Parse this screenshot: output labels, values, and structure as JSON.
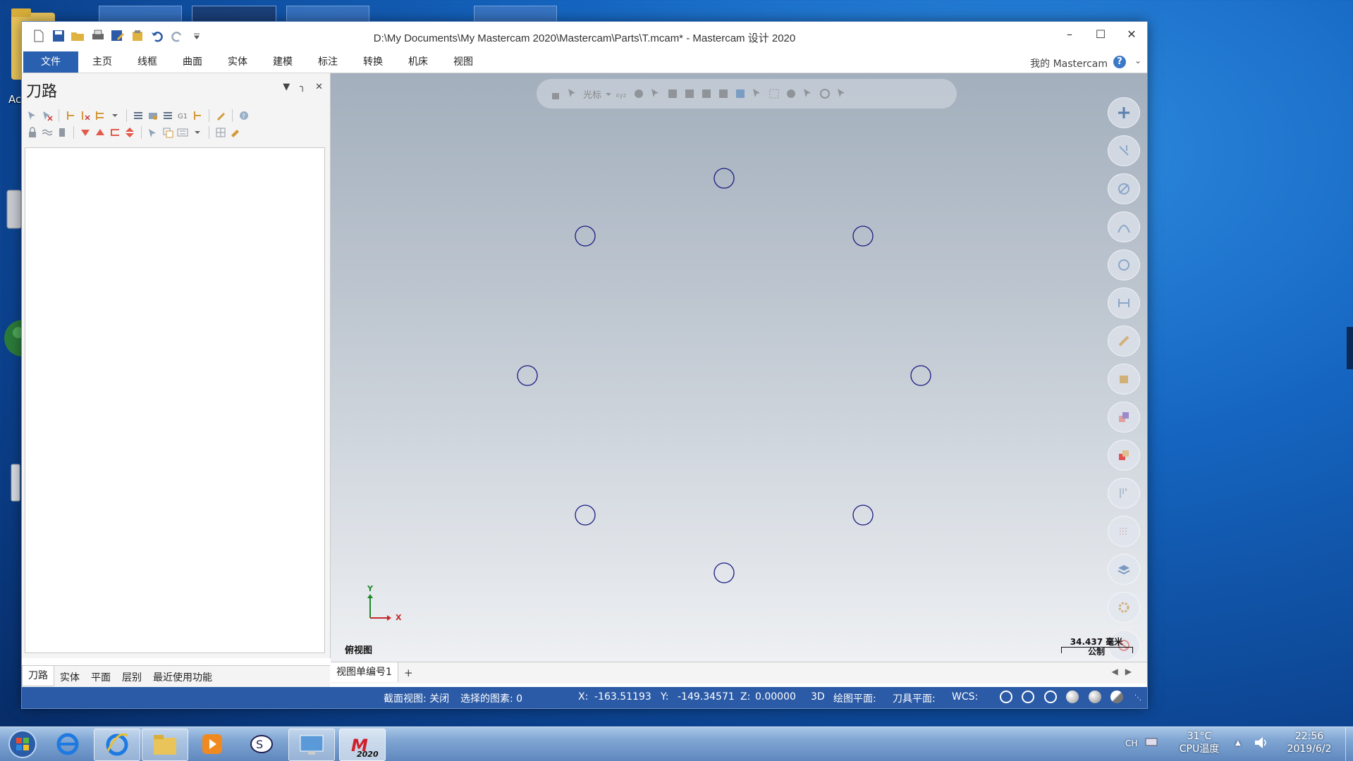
{
  "desktop": {
    "icon_label": "Ac",
    "icons": [
      "folder-icon",
      "drive-icon",
      "globe-icon",
      "recycle-bin-icon"
    ]
  },
  "window": {
    "title": "D:\\My Documents\\My Mastercam 2020\\Mastercam\\Parts\\T.mcam* - Mastercam 设计 2020",
    "controls": [
      "minimize-icon",
      "maximize-icon",
      "close-icon"
    ],
    "quick_access": [
      "new-icon",
      "save-icon",
      "open-icon",
      "print-icon",
      "save-as-icon",
      "properties-icon",
      "undo-icon",
      "redo-icon",
      "customize-icon"
    ]
  },
  "ribbon": {
    "tabs": [
      "文件",
      "主页",
      "线框",
      "曲面",
      "实体",
      "建模",
      "标注",
      "转换",
      "机床",
      "视图"
    ],
    "active_tab": "文件",
    "my_mastercam": "我的 Mastercam"
  },
  "panel": {
    "title": "刀路",
    "bottom_tabs": [
      "刀路",
      "实体",
      "平面",
      "层别",
      "最近使用功能"
    ],
    "active_bottom_tab": "刀路"
  },
  "viewport": {
    "toolbar_label": "光标",
    "axis_x": "X",
    "axis_y": "Y",
    "view_name": "俯视图",
    "scale_value": "34.437 毫米",
    "scale_unit": "公制",
    "tab_label": "视图单编号1",
    "add_tab": "+",
    "circle_color": "#1a1a80",
    "right_tools": [
      "add-icon",
      "trim-icon",
      "circle-icon",
      "spline-icon",
      "solid-icon",
      "dimension-icon",
      "measure-icon",
      "box-icon",
      "boolean-icon",
      "color-icon",
      "analyze-icon",
      "grid-icon",
      "layers-icon",
      "settings-icon",
      "disable-icon"
    ]
  },
  "status": {
    "section_view": "截面视图: 关闭",
    "selected": "选择的图素: 0",
    "x_label": "X:",
    "x_value": "-163.51193",
    "y_label": "Y:",
    "y_value": "-149.34571",
    "z_label": "Z:",
    "z_value": "0.00000",
    "mode": "3D",
    "cplane": "绘图平面:",
    "tplane": "刀具平面:",
    "wcs": "WCS:"
  },
  "taskbar": {
    "apps": [
      "start-icon",
      "ie-icon",
      "ie-pinned-icon",
      "explorer-icon",
      "media-player-icon",
      "recorder-icon",
      "remote-desktop-icon",
      "mastercam-icon"
    ],
    "mastercam_label": "2020",
    "lang": "CH",
    "temp_value": "31°C",
    "temp_label": "CPU温度",
    "time": "22:56",
    "date": "2019/6/2"
  }
}
